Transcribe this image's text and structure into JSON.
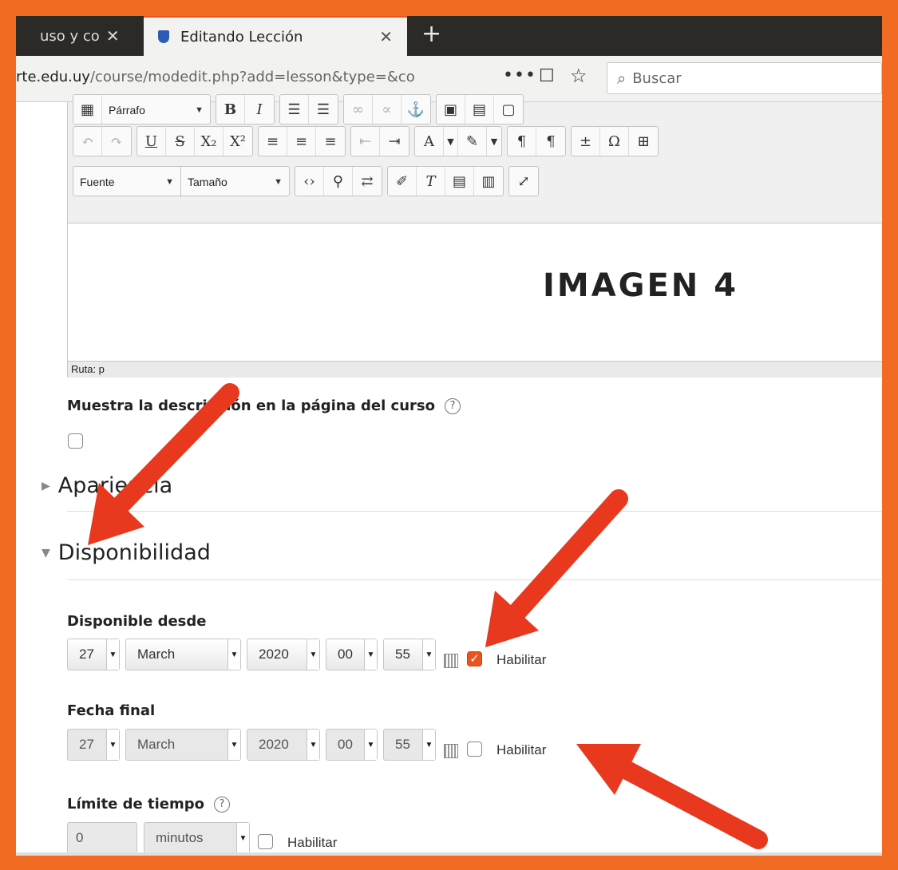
{
  "browser": {
    "tabs": [
      {
        "label": "uso y co"
      },
      {
        "label": "Editando Lección"
      }
    ],
    "url_host": "rte.edu.uy",
    "url_path": "/course/modedit.php?add=lesson&type=&co",
    "url_more": "•••",
    "search_placeholder": "Buscar"
  },
  "editor": {
    "font_combo": "Fuente",
    "size_combo": "Tamaño",
    "paragraph_combo": "Párrafo",
    "overlay_title": "IMAGEN 4",
    "path_label": "Ruta: p"
  },
  "form": {
    "show_desc_label": "Muestra la descripción en la página del curso",
    "show_desc_checked": false,
    "appearance_header": "Apariencia",
    "availability_header": "Disponibilidad",
    "available_from": {
      "label": "Disponible desde",
      "day": "27",
      "month": "March",
      "year": "2020",
      "hour": "00",
      "minute": "55",
      "enable_label": "Habilitar",
      "enabled": true
    },
    "deadline": {
      "label": "Fecha final",
      "day": "27",
      "month": "March",
      "year": "2020",
      "hour": "00",
      "minute": "55",
      "enable_label": "Habilitar",
      "enabled": false
    },
    "time_limit": {
      "label": "Límite de tiempo",
      "value": "0",
      "unit": "minutos",
      "enable_label": "Habilitar",
      "enabled": false
    }
  },
  "colors": {
    "border_frame": "#f26b22",
    "annotation_arrow": "#e8391f",
    "checkbox_checked": "#e95420"
  }
}
